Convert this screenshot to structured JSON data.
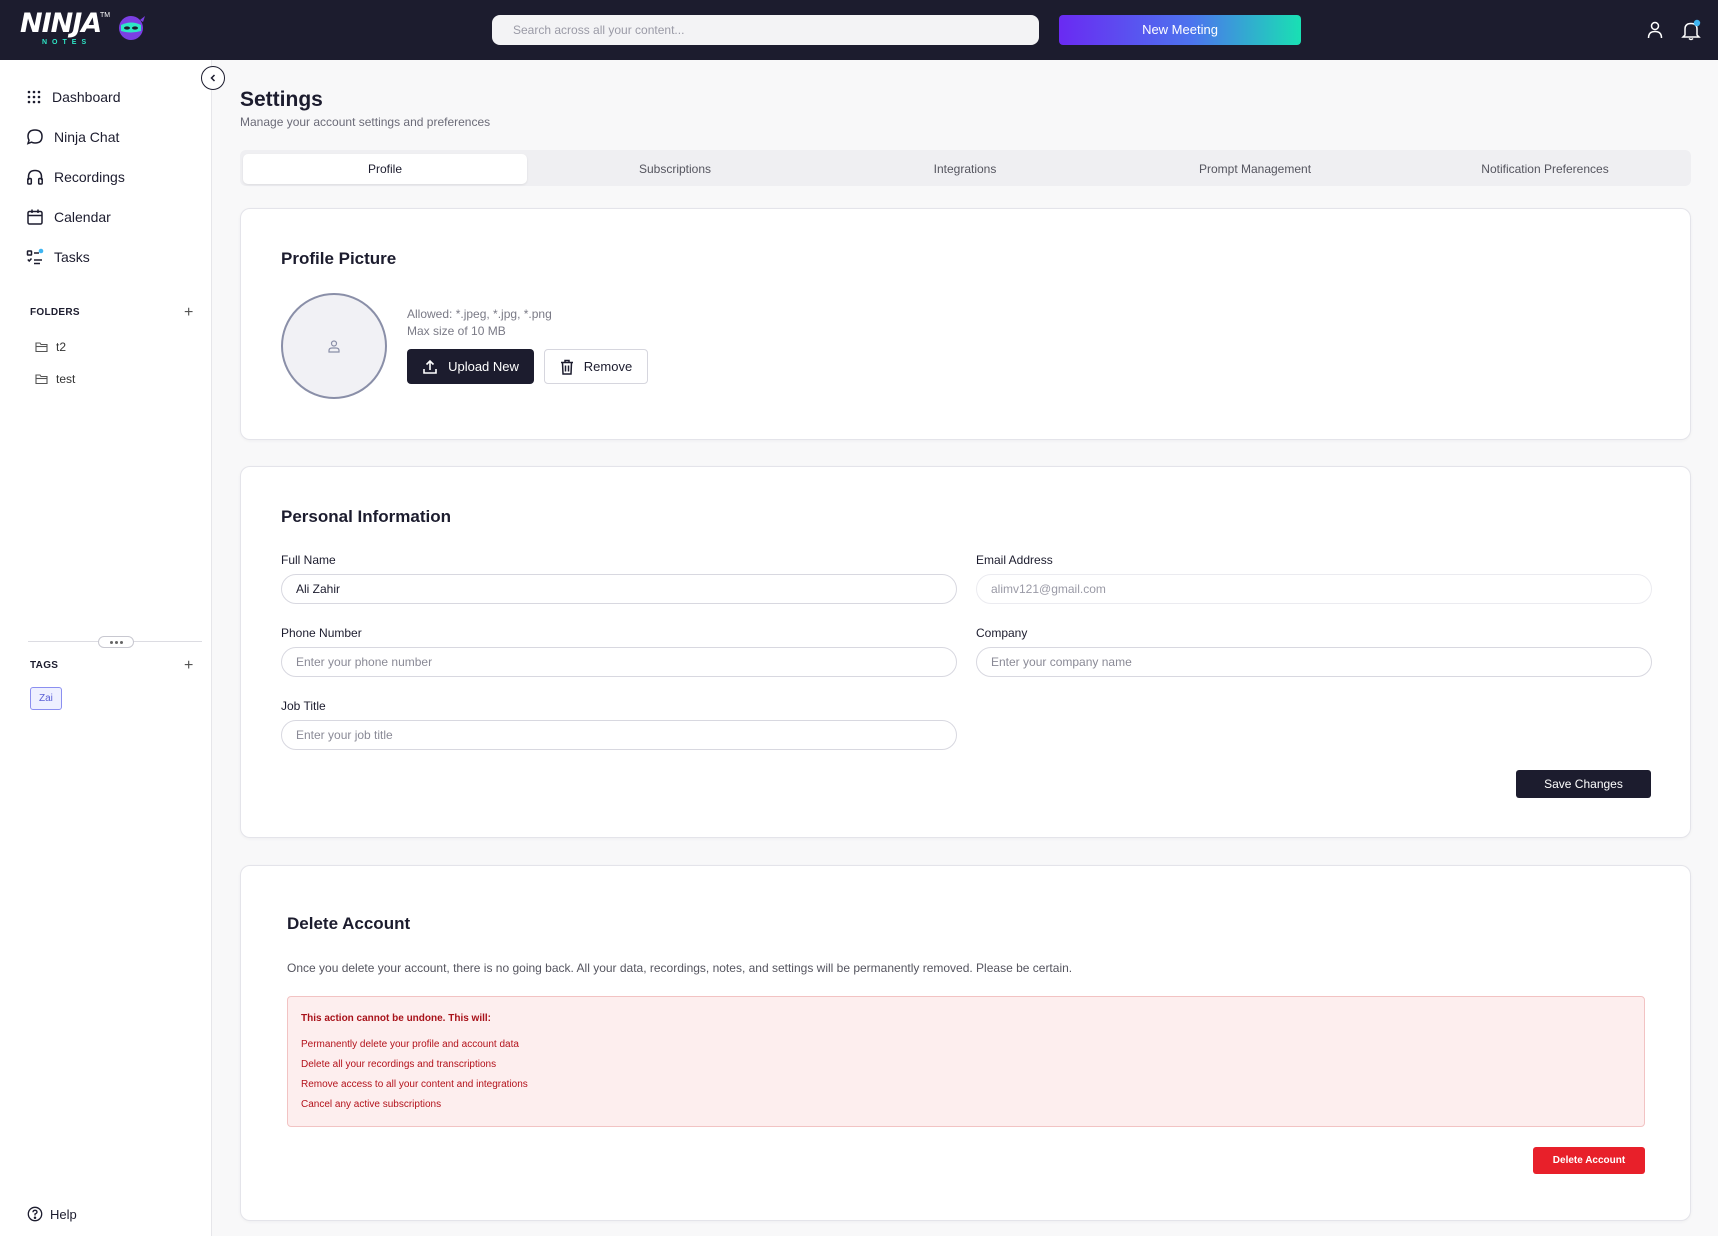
{
  "app": {
    "logo_text": "NINJA",
    "logo_subtext": "NOTES",
    "logo_tm": "TM"
  },
  "topbar": {
    "search_placeholder": "Search across all your content...",
    "new_meeting_label": "New Meeting",
    "user_icon": "user-icon",
    "bell_icon": "bell-icon"
  },
  "sidebar": {
    "nav": [
      {
        "label": "Dashboard",
        "icon": "grid-icon"
      },
      {
        "label": "Ninja Chat",
        "icon": "chat-bubble-icon"
      },
      {
        "label": "Recordings",
        "icon": "headphones-icon"
      },
      {
        "label": "Calendar",
        "icon": "calendar-icon"
      },
      {
        "label": "Tasks",
        "icon": "tasks-icon"
      }
    ],
    "folders_label": "FOLDERS",
    "folders": [
      "t2",
      "test"
    ],
    "tags_label": "TAGS",
    "tags": [
      "Zai"
    ],
    "help_label": "Help"
  },
  "settings": {
    "title": "Settings",
    "subtitle": "Manage your account settings and preferences",
    "tabs": [
      "Profile",
      "Subscriptions",
      "Integrations",
      "Prompt Management",
      "Notification Preferences"
    ],
    "active_tab": "Profile"
  },
  "profile_picture": {
    "title": "Profile Picture",
    "allowed": "Allowed: *.jpeg, *.jpg, *.png",
    "max_size": "Max size of 10 MB",
    "upload_label": "Upload New",
    "remove_label": "Remove"
  },
  "personal_info": {
    "title": "Personal Information",
    "full_name_label": "Full Name",
    "full_name_value": "Ali Zahir",
    "email_label": "Email Address",
    "email_value": "alimv121@gmail.com",
    "phone_label": "Phone Number",
    "phone_placeholder": "Enter your phone number",
    "company_label": "Company",
    "company_placeholder": "Enter your company name",
    "job_label": "Job Title",
    "job_placeholder": "Enter your job title",
    "save_label": "Save Changes"
  },
  "delete_account": {
    "title": "Delete Account",
    "description": "Once you delete your account, there is no going back. All your data, recordings, notes, and settings will be permanently removed. Please be certain.",
    "warning_heading": "This action cannot be undone. This will:",
    "warning_items": [
      "Permanently delete your profile and account data",
      "Delete all your recordings and transcriptions",
      "Remove access to all your content and integrations",
      "Cancel any active subscriptions"
    ],
    "delete_label": "Delete Account"
  },
  "colors": {
    "topbar_bg": "#1c1c2e",
    "primary_dark": "#1c1c2e",
    "gradient_start": "#6a2af2",
    "gradient_end": "#19e0b3",
    "danger": "#e8202a",
    "danger_bg": "#fdeeee",
    "tag_accent": "#8b8ff0"
  }
}
